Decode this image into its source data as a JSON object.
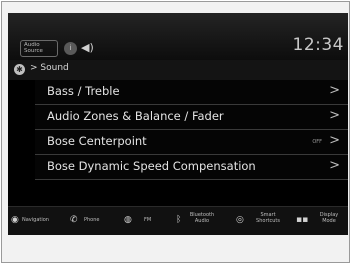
{
  "header": {
    "source_label": "Audio Source",
    "clock": "12:34"
  },
  "breadcrumb": {
    "label": "Sound"
  },
  "menu": [
    {
      "label": "Bass / Treble",
      "status": ""
    },
    {
      "label": "Audio Zones & Balance / Fader",
      "status": ""
    },
    {
      "label": "Bose Centerpoint",
      "status": "OFF"
    },
    {
      "label": "Bose Dynamic Speed Compensation",
      "status": ""
    }
  ],
  "bottom_nav": [
    {
      "label": "Navigation",
      "icon": "navigation-icon"
    },
    {
      "label": "Phone",
      "icon": "phone-icon"
    },
    {
      "label": "FM",
      "icon": "radio-icon"
    },
    {
      "label": "Bluetooth Audio",
      "icon": "bluetooth-icon"
    },
    {
      "label": "Smart Shortcuts",
      "icon": "shortcuts-icon"
    },
    {
      "label": "Display Mode",
      "icon": "display-mode-icon"
    }
  ]
}
